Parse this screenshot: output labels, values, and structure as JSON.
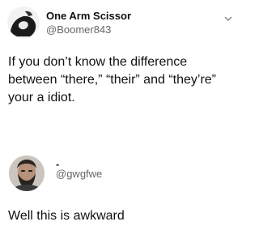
{
  "original_tweet": {
    "author_name": "One Arm Scissor",
    "author_handle": "@Boomer843",
    "avatar_icon": "black-white-portrait-avatar",
    "menu_icon": "chevron-down-icon",
    "text": "If you don’t know the difference between “there,” “their” and “they’re” your a idiot."
  },
  "reply": {
    "author_name": "-",
    "author_handle": "@gwgfwe",
    "avatar_icon": "bearded-man-avatar",
    "text": "Well this is awkward"
  }
}
